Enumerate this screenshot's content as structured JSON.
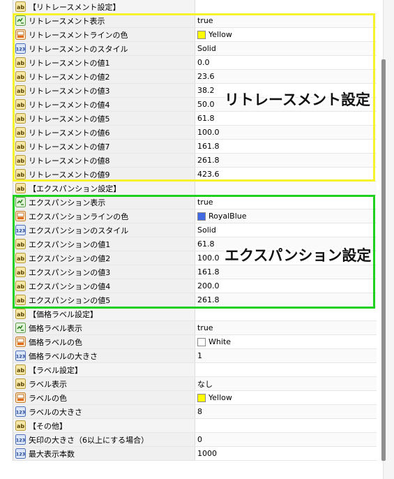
{
  "colors": {
    "fibo_highlight": "#f7f32a",
    "expansion_highlight": "#1fd11f",
    "yellow": "#ffff00",
    "royal_blue": "#4169e1",
    "white": "#ffffff"
  },
  "callouts": {
    "fibo": "リトレースメント設定",
    "expansion": "エクスパンション設定"
  },
  "rows": [
    {
      "icon": "ab",
      "name": "【リトレースメント設定】",
      "value": ""
    },
    {
      "icon": "bool",
      "name": "リトレースメント表示",
      "value": "true"
    },
    {
      "icon": "color",
      "name": "リトレースメントラインの色",
      "value": "Yellow",
      "swatch": "#ffff00"
    },
    {
      "icon": "num",
      "name": "リトレースメントのスタイル",
      "value": "Solid"
    },
    {
      "icon": "ab",
      "name": "リトレースメントの値1",
      "value": "0.0"
    },
    {
      "icon": "ab",
      "name": "リトレースメントの値2",
      "value": "23.6"
    },
    {
      "icon": "ab",
      "name": "リトレースメントの値3",
      "value": "38.2"
    },
    {
      "icon": "ab",
      "name": "リトレースメントの値4",
      "value": "50.0"
    },
    {
      "icon": "ab",
      "name": "リトレースメントの値5",
      "value": "61.8"
    },
    {
      "icon": "ab",
      "name": "リトレースメントの値6",
      "value": "100.0"
    },
    {
      "icon": "ab",
      "name": "リトレースメントの値7",
      "value": "161.8"
    },
    {
      "icon": "ab",
      "name": "リトレースメントの値8",
      "value": "261.8"
    },
    {
      "icon": "ab",
      "name": "リトレースメントの値9",
      "value": "423.6"
    },
    {
      "icon": "ab",
      "name": "【エクスパンション設定】",
      "value": ""
    },
    {
      "icon": "bool",
      "name": "エクスパンション表示",
      "value": "true"
    },
    {
      "icon": "color",
      "name": "エクスパンションラインの色",
      "value": "RoyalBlue",
      "swatch": "#4169e1"
    },
    {
      "icon": "num",
      "name": "エクスパンションのスタイル",
      "value": "Solid"
    },
    {
      "icon": "ab",
      "name": "エクスパンションの値1",
      "value": "61.8"
    },
    {
      "icon": "ab",
      "name": "エクスパンションの値2",
      "value": "100.0"
    },
    {
      "icon": "ab",
      "name": "エクスパンションの値3",
      "value": "161.8"
    },
    {
      "icon": "ab",
      "name": "エクスパンションの値4",
      "value": "200.0"
    },
    {
      "icon": "ab",
      "name": "エクスパンションの値5",
      "value": "261.8"
    },
    {
      "icon": "ab",
      "name": "【価格ラベル設定】",
      "value": ""
    },
    {
      "icon": "bool",
      "name": "価格ラベル表示",
      "value": "true"
    },
    {
      "icon": "color",
      "name": "価格ラベルの色",
      "value": "White",
      "swatch": "#ffffff"
    },
    {
      "icon": "num",
      "name": "価格ラベルの大きさ",
      "value": "1"
    },
    {
      "icon": "ab",
      "name": "【ラベル設定】",
      "value": ""
    },
    {
      "icon": "ab",
      "name": "ラベル表示",
      "value": "なし"
    },
    {
      "icon": "color",
      "name": "ラベルの色",
      "value": "Yellow",
      "swatch": "#ffff00"
    },
    {
      "icon": "num",
      "name": "ラベルの大きさ",
      "value": "8"
    },
    {
      "icon": "ab",
      "name": "【その他】",
      "value": ""
    },
    {
      "icon": "num",
      "name": "矢印の大きさ（6以上にする場合）",
      "value": "0"
    },
    {
      "icon": "num",
      "name": "最大表示本数",
      "value": "1000"
    }
  ]
}
